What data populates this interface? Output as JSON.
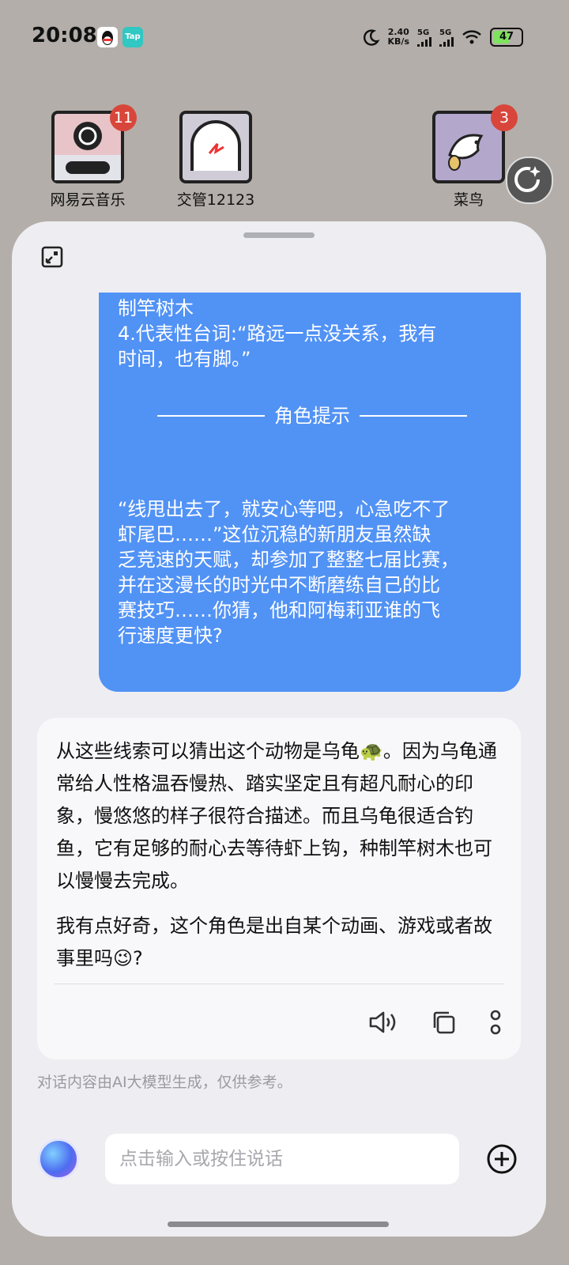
{
  "status_bar": {
    "time": "20:08",
    "tap_label": "Tap",
    "net_speed_value": "2.40",
    "net_speed_unit": "KB/s",
    "sim1": "5G",
    "sim2": "5G",
    "battery": "47"
  },
  "home_apps": [
    {
      "label": "网易云音乐",
      "badge": "11"
    },
    {
      "label": "交管12123",
      "badge": ""
    },
    {
      "label": "菜鸟",
      "badge": "3"
    }
  ],
  "user_message": {
    "lines": [
      "制竿树木",
      "4.代表性台词:“路远一点没关系，我有",
      "时间，也有脚。”"
    ],
    "divider_label": "角色提示",
    "hint_lines": [
      "“线甩出去了，就安心等吧，心急吃不了",
      "虾尾巴……”这位沉稳的新朋友虽然缺",
      "乏竞速的天赋，却参加了整整七届比赛，",
      "并在这漫长的时光中不断磨练自己的比",
      "赛技巧……你猜，他和阿梅莉亚谁的飞",
      "行速度更快?"
    ]
  },
  "ai_message": {
    "paragraph1": "从这些线索可以猜出这个动物是乌龟🐢。因为乌龟通常给人性格温吞慢热、踏实坚定且有超凡耐心的印象，慢悠悠的样子很符合描述。而且乌龟很适合钓鱼，它有足够的耐心去等待虾上钩，种制竿树木也可以慢慢去完成。",
    "paragraph2": "我有点好奇，这个角色是出自某个动画、游戏或者故事里吗😉?"
  },
  "disclaimer": "对话内容由AI大模型生成，仅供参考。",
  "input": {
    "placeholder": "点击输入或按住说话",
    "value": ""
  }
}
